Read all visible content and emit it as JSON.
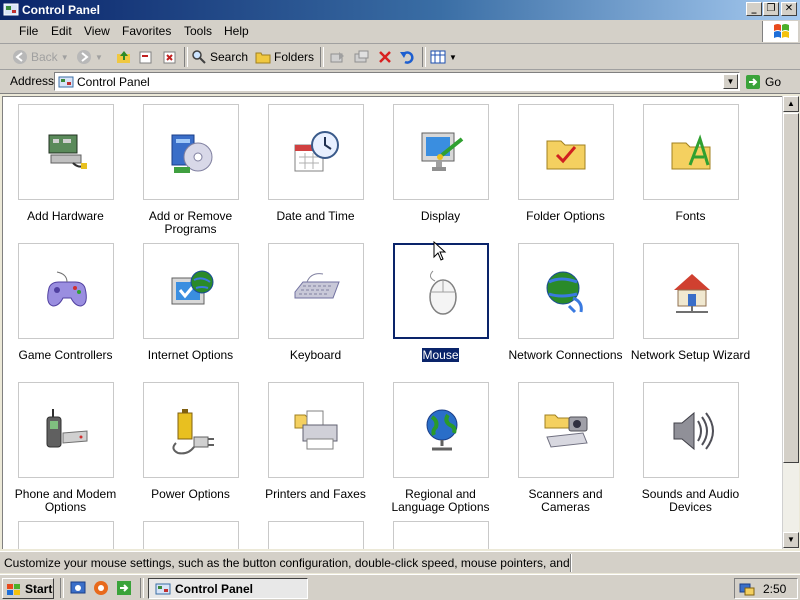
{
  "window": {
    "title": "Control Panel"
  },
  "menu": [
    "File",
    "Edit",
    "View",
    "Favorites",
    "Tools",
    "Help"
  ],
  "toolbar": {
    "back": "Back",
    "search": "Search",
    "folders": "Folders"
  },
  "address": {
    "label": "Address",
    "value": "Control Panel",
    "go": "Go"
  },
  "items": [
    {
      "label": "Add Hardware",
      "icon": "add-hardware-icon"
    },
    {
      "label": "Add or Remove Programs",
      "icon": "add-remove-programs-icon"
    },
    {
      "label": "Date and Time",
      "icon": "date-time-icon"
    },
    {
      "label": "Display",
      "icon": "display-icon"
    },
    {
      "label": "Folder Options",
      "icon": "folder-options-icon"
    },
    {
      "label": "Fonts",
      "icon": "fonts-icon"
    },
    {
      "label": "Game Controllers",
      "icon": "game-controllers-icon"
    },
    {
      "label": "Internet Options",
      "icon": "internet-options-icon"
    },
    {
      "label": "Keyboard",
      "icon": "keyboard-icon"
    },
    {
      "label": "Mouse",
      "icon": "mouse-icon",
      "selected": true
    },
    {
      "label": "Network Connections",
      "icon": "network-connections-icon"
    },
    {
      "label": "Network Setup Wizard",
      "icon": "network-setup-wizard-icon"
    },
    {
      "label": "Phone and Modem Options",
      "icon": "phone-modem-icon"
    },
    {
      "label": "Power Options",
      "icon": "power-options-icon"
    },
    {
      "label": "Printers and Faxes",
      "icon": "printers-faxes-icon"
    },
    {
      "label": "Regional and Language Options",
      "icon": "regional-language-icon"
    },
    {
      "label": "Scanners and Cameras",
      "icon": "scanners-cameras-icon"
    },
    {
      "label": "Sounds and Audio Devices",
      "icon": "sounds-audio-icon"
    },
    {
      "label": "",
      "icon": "item-icon"
    },
    {
      "label": "",
      "icon": "item-icon"
    },
    {
      "label": "",
      "icon": "item-icon"
    },
    {
      "label": "",
      "icon": "item-icon"
    }
  ],
  "status": {
    "text": "Customize your mouse settings, such as the button configuration, double-click speed, mouse pointers, and motion spe"
  },
  "taskbar": {
    "start": "Start",
    "window": "Control Panel",
    "clock": "2:50"
  }
}
